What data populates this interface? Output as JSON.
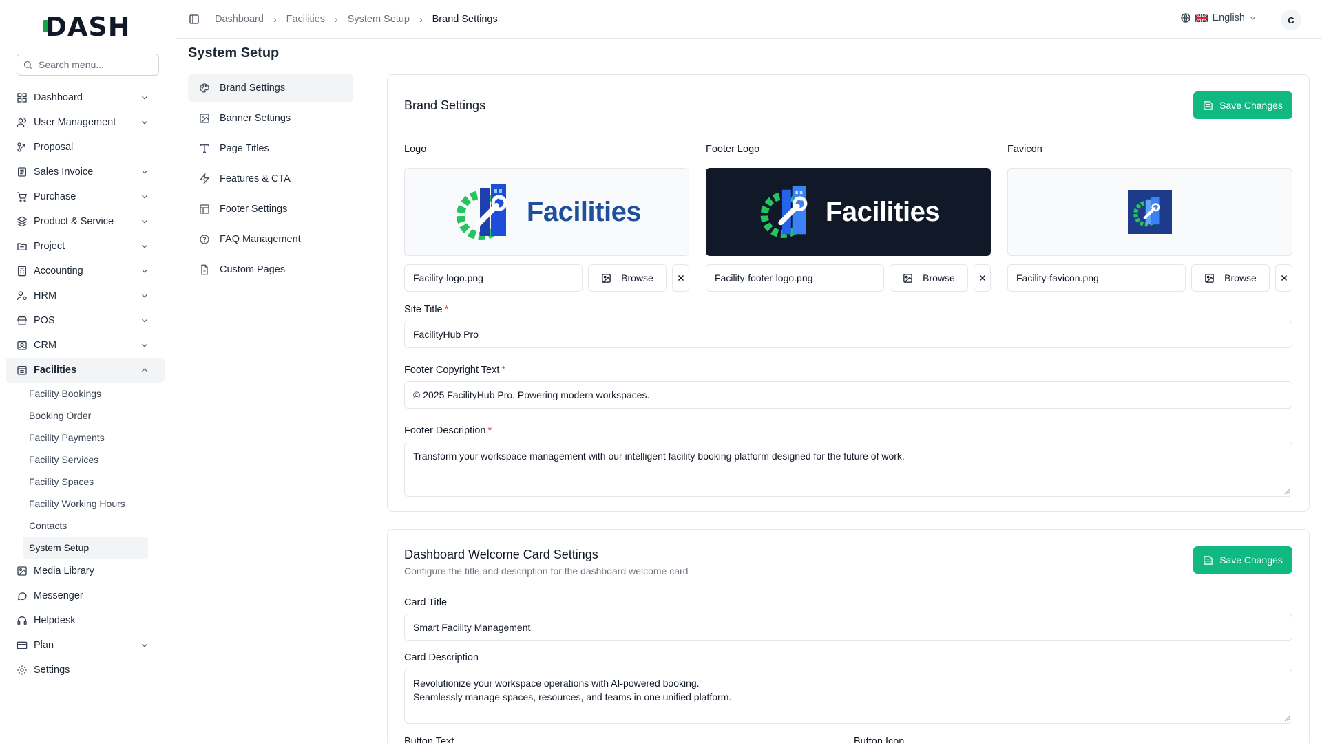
{
  "app": {
    "brand": "DASH",
    "user_initial": "C",
    "language": "English"
  },
  "search": {
    "placeholder": "Search menu..."
  },
  "sidebar": {
    "items": [
      {
        "label": "Dashboard",
        "icon": "grid-icon",
        "expandable": true
      },
      {
        "label": "User Management",
        "icon": "users-icon",
        "expandable": true
      },
      {
        "label": "Proposal",
        "icon": "proposal-icon",
        "expandable": false
      },
      {
        "label": "Sales Invoice",
        "icon": "invoice-icon",
        "expandable": true
      },
      {
        "label": "Purchase",
        "icon": "cart-icon",
        "expandable": true
      },
      {
        "label": "Product & Service",
        "icon": "layers-icon",
        "expandable": true
      },
      {
        "label": "Project",
        "icon": "folder-icon",
        "expandable": true
      },
      {
        "label": "Accounting",
        "icon": "calculator-icon",
        "expandable": true
      },
      {
        "label": "HRM",
        "icon": "user-cog-icon",
        "expandable": true
      },
      {
        "label": "POS",
        "icon": "store-icon",
        "expandable": true
      },
      {
        "label": "CRM",
        "icon": "contact-icon",
        "expandable": true
      },
      {
        "label": "Facilities",
        "icon": "building-icon",
        "expandable": true,
        "expanded": true
      }
    ],
    "facilities_sub": [
      "Facility Bookings",
      "Booking Order",
      "Facility Payments",
      "Facility Services",
      "Facility Spaces",
      "Facility Working Hours",
      "Contacts",
      "System Setup"
    ],
    "bottom_items": [
      {
        "label": "Media Library",
        "icon": "image-icon",
        "expandable": false
      },
      {
        "label": "Messenger",
        "icon": "chat-icon",
        "expandable": false
      },
      {
        "label": "Helpdesk",
        "icon": "headset-icon",
        "expandable": false
      },
      {
        "label": "Plan",
        "icon": "plan-icon",
        "expandable": true
      },
      {
        "label": "Settings",
        "icon": "gear-icon",
        "expandable": false
      }
    ]
  },
  "breadcrumb": [
    "Dashboard",
    "Facilities",
    "System Setup",
    "Brand Settings"
  ],
  "page": {
    "title": "System Setup"
  },
  "settings_menu": [
    {
      "label": "Brand Settings",
      "icon": "palette-icon",
      "active": true
    },
    {
      "label": "Banner Settings",
      "icon": "image-icon"
    },
    {
      "label": "Page Titles",
      "icon": "type-icon"
    },
    {
      "label": "Features & CTA",
      "icon": "zap-icon"
    },
    {
      "label": "Footer Settings",
      "icon": "layout-icon"
    },
    {
      "label": "FAQ Management",
      "icon": "help-circle-icon"
    },
    {
      "label": "Custom Pages",
      "icon": "file-icon"
    }
  ],
  "brand_settings": {
    "title": "Brand Settings",
    "save_label": "Save Changes",
    "browse_label": "Browse",
    "logo_word": "Facilities",
    "logo": {
      "label": "Logo",
      "file": "Facility-logo.png"
    },
    "footer_logo": {
      "label": "Footer Logo",
      "file": "Facility-footer-logo.png"
    },
    "favicon": {
      "label": "Favicon",
      "file": "Facility-favicon.png"
    },
    "site_title": {
      "label": "Site Title",
      "value": "FacilityHub Pro"
    },
    "copyright": {
      "label": "Footer Copyright Text",
      "value": "© 2025 FacilityHub Pro. Powering modern workspaces."
    },
    "footer_description": {
      "label": "Footer Description",
      "value": "Transform your workspace management with our intelligent facility booking platform designed for the future of work."
    }
  },
  "welcome_card": {
    "title": "Dashboard Welcome Card Settings",
    "subtitle": "Configure the title and description for the dashboard welcome card",
    "save_label": "Save Changes",
    "card_title": {
      "label": "Card Title",
      "value": "Smart Facility Management"
    },
    "card_description": {
      "label": "Card Description",
      "line1": "Revolutionize your workspace operations with AI-powered booking.",
      "line2": "Seamlessly manage spaces, resources, and teams in one unified platform."
    },
    "button_text": {
      "label": "Button Text"
    },
    "button_icon": {
      "label": "Button Icon"
    }
  },
  "colors": {
    "accent": "#10b981",
    "brand_blue": "#1e4f9c",
    "brand_green": "#22c55e",
    "required": "#ef4444"
  }
}
